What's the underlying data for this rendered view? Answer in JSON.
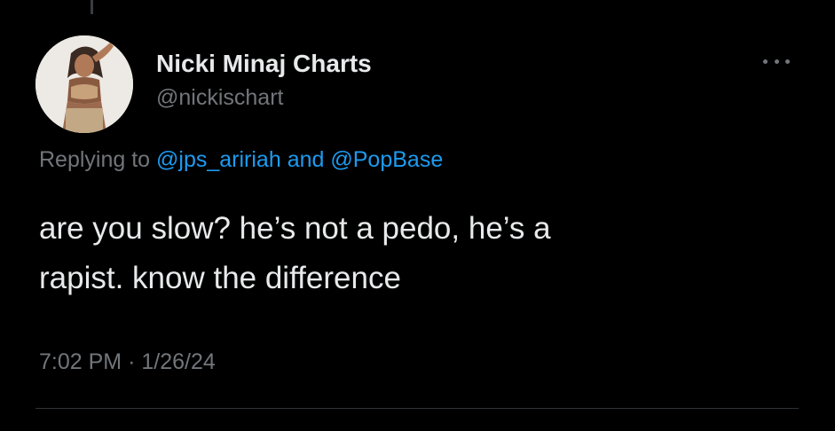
{
  "author": {
    "display_name": "Nicki Minaj Charts",
    "handle": "@nickischart",
    "avatar": "profile-photo"
  },
  "reply_context": {
    "prefix": "Replying to",
    "mention_1": "@jps_aririah",
    "connector": "and",
    "mention_2": "@PopBase"
  },
  "tweet": {
    "text_line_1": "are you slow? he’s not a pedo, he’s a",
    "text_line_2": "rapist. know the difference",
    "time": "7:02 PM",
    "separator": "·",
    "date": "1/26/24"
  },
  "icons": {
    "more": "more-horizontal-icon"
  },
  "colors": {
    "background": "#000000",
    "text": "#e7e9ea",
    "secondary": "#71767b",
    "link": "#1d9bf0"
  }
}
